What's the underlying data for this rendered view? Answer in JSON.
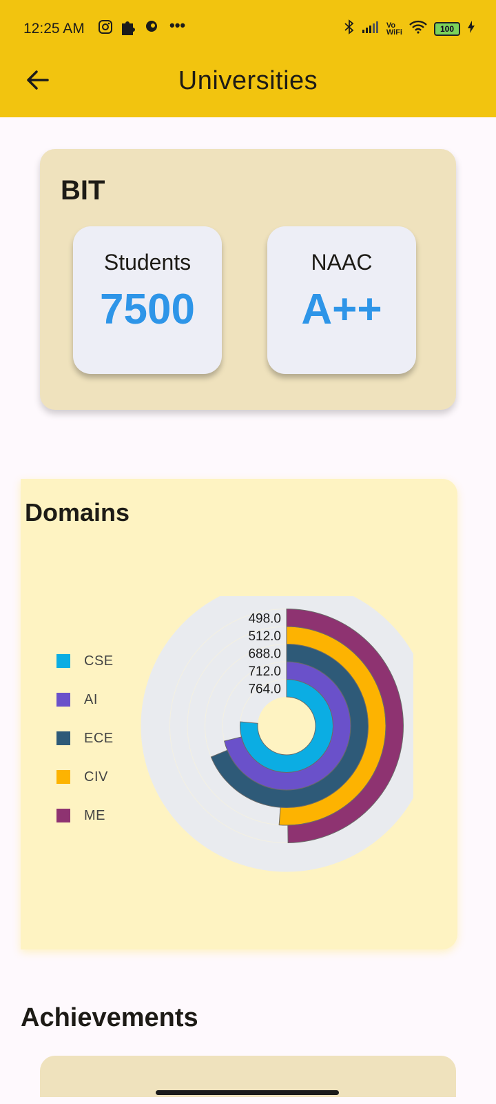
{
  "status_bar": {
    "time": "12:25 AM",
    "battery": "100"
  },
  "app_bar": {
    "title": "Universities"
  },
  "university": {
    "name": "BIT",
    "stats": [
      {
        "label": "Students",
        "value": "7500"
      },
      {
        "label": "NAAC",
        "value": "A++"
      }
    ]
  },
  "domains": {
    "title": "Domains",
    "legend": [
      {
        "label": "CSE",
        "color": "#0BADE3"
      },
      {
        "label": "AI",
        "color": "#6A51CA"
      },
      {
        "label": "ECE",
        "color": "#2E5A78"
      },
      {
        "label": "CIV",
        "color": "#FDB301"
      },
      {
        "label": "ME",
        "color": "#8E3371"
      }
    ]
  },
  "chart_data": {
    "type": "radial-bar",
    "categories": [
      "CSE",
      "AI",
      "ECE",
      "CIV",
      "ME"
    ],
    "values": [
      764.0,
      712.0,
      688.0,
      512.0,
      498.0
    ],
    "data_labels": [
      "764.0",
      "712.0",
      "688.0",
      "512.0",
      "498.0"
    ],
    "colors": [
      "#0BADE3",
      "#6A51CA",
      "#2E5A78",
      "#FDB301",
      "#8E3371"
    ],
    "max": 1000,
    "track_color": "#E9EBEF",
    "legend_position": "left"
  },
  "achievements": {
    "title": "Achievements"
  }
}
